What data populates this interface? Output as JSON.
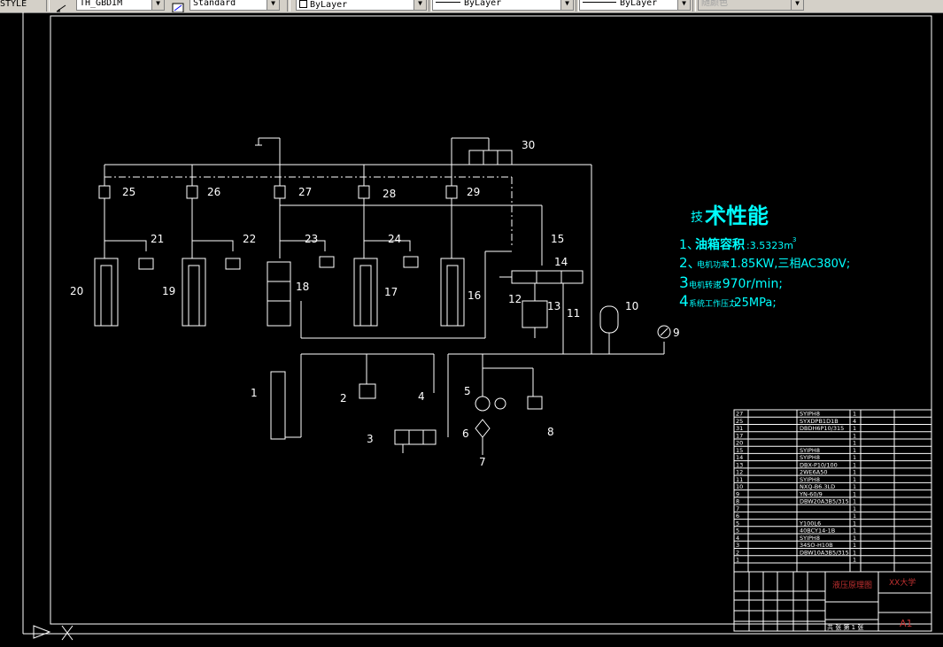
{
  "toolbar": {
    "text_style_label": "STYLE",
    "text_style_value": "TH_GBDIM",
    "dim_style_value": "Standard",
    "layer_value": "ByLayer",
    "linetype_value": "ByLayer",
    "lineweight_value": "ByLayer",
    "color_value": "随颜色",
    "colors": {
      "bar": "#d4d0c8",
      "canvas": "#000000",
      "annotation": "#00ffff"
    }
  },
  "schematic": {
    "component_numbers": [
      "1",
      "2",
      "3",
      "4",
      "5",
      "6",
      "7",
      "8",
      "9",
      "10",
      "11",
      "12",
      "13",
      "14",
      "15",
      "16",
      "17",
      "18",
      "19",
      "20",
      "21",
      "22",
      "23",
      "24",
      "25",
      "26",
      "27",
      "28",
      "29",
      "30"
    ]
  },
  "spec": {
    "title_small": "技",
    "title_large": "术性能",
    "line1_num": "1、",
    "line1_label": "油箱容积",
    "line1_value": ":3.5323m",
    "line1_sup": "3",
    "line2_num": "2、",
    "line2_label": "电机功率",
    "line2_value": ":1.85KW,三相AC380V;",
    "line3_num": "3",
    "line3_label": "电机转速",
    "line3_value": ":970r/min;",
    "line4_num": "4",
    "line4_label": "系统工作压力",
    "line4_value": ":25MPa;"
  },
  "title_block": {
    "bom_rows": [
      {
        "no": "27",
        "code": "SYIPH8",
        "qty": "1"
      },
      {
        "no": "25",
        "code": "SYXDPB1D1B",
        "qty": "4"
      },
      {
        "no": "31",
        "code": "DBDH6P10/315",
        "qty": "1"
      },
      {
        "no": "17",
        "code": "",
        "qty": "1"
      },
      {
        "no": "20",
        "code": "",
        "qty": "1"
      },
      {
        "no": "15",
        "code": "SYIPH8",
        "qty": "1"
      },
      {
        "no": "14",
        "code": "SYIPH8",
        "qty": "1"
      },
      {
        "no": "13",
        "code": "DBX-P10/100",
        "qty": "1"
      },
      {
        "no": "12",
        "code": "2WE6A50",
        "qty": "1"
      },
      {
        "no": "11",
        "code": "SYIPH8",
        "qty": "1"
      },
      {
        "no": "10",
        "code": "NXQ-B6.3LD",
        "qty": "1"
      },
      {
        "no": "9",
        "code": "YN-60/9",
        "qty": "1"
      },
      {
        "no": "8",
        "code": "DBW20A3B5/315",
        "qty": "1"
      },
      {
        "no": "7",
        "code": "",
        "qty": "1"
      },
      {
        "no": "6",
        "code": "",
        "qty": "1"
      },
      {
        "no": "5",
        "code": "Y100L6",
        "qty": "1"
      },
      {
        "no": "5",
        "code": "40BCY14-1B",
        "qty": "1"
      },
      {
        "no": "4",
        "code": "SYIPH8",
        "qty": "1"
      },
      {
        "no": "3",
        "code": "34SO-H10B",
        "qty": "1"
      },
      {
        "no": "2",
        "code": "DBW10A3B5/315",
        "qty": "1"
      },
      {
        "no": "1",
        "code": "",
        "qty": "1"
      }
    ],
    "drawing_title": "液压原理图",
    "school": "XX大学",
    "sheet_size": "A1",
    "sheet_info": "共 张 第 1 张"
  }
}
